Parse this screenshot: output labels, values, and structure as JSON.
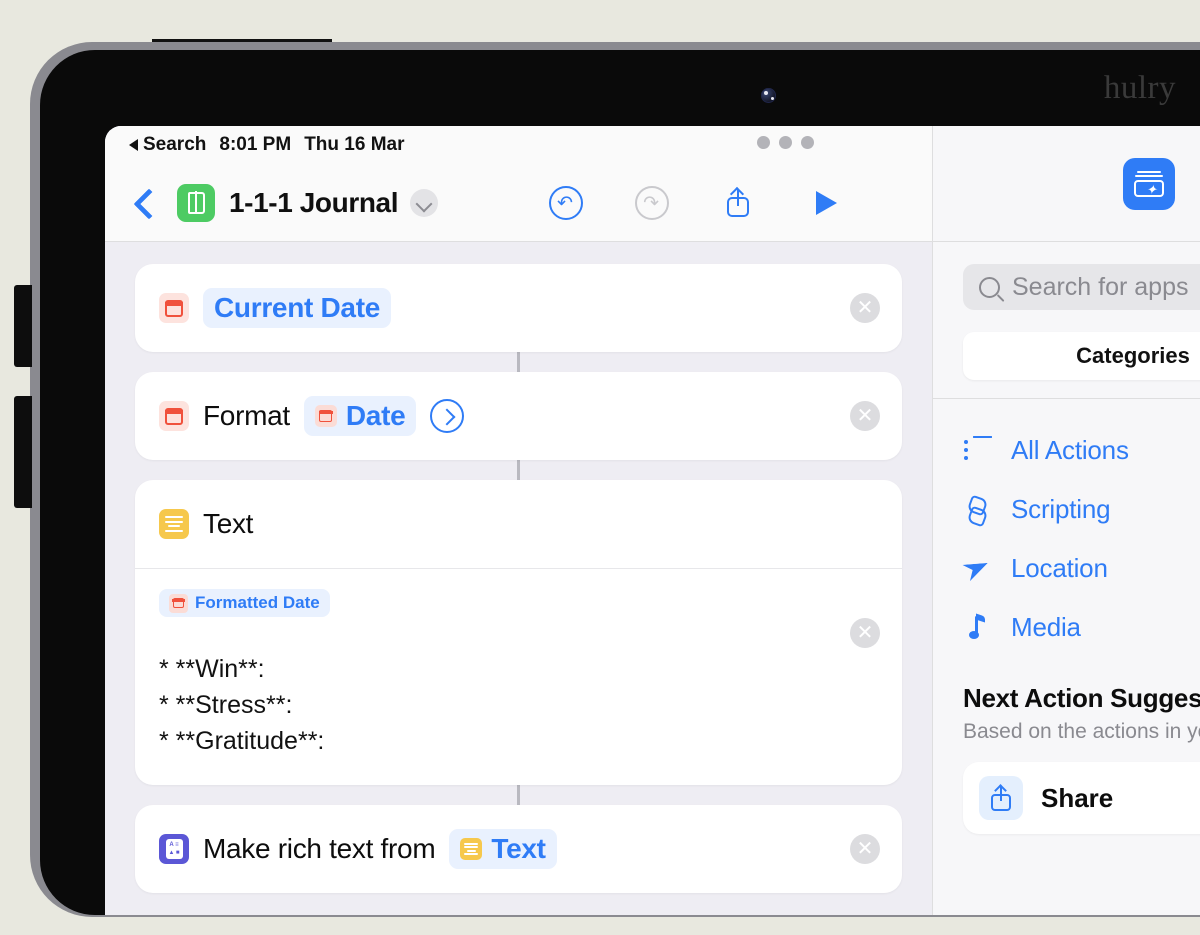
{
  "device": {
    "watermark": "hulry"
  },
  "statusbar": {
    "back_label": "Search",
    "time": "8:01 PM",
    "date": "Thu 16 Mar"
  },
  "navbar": {
    "shortcut_title": "1-1-1 Journal",
    "app_icon": "book-icon",
    "tools": [
      {
        "name": "undo-button",
        "label": "Undo",
        "enabled": true
      },
      {
        "name": "redo-button",
        "label": "Redo",
        "enabled": false
      },
      {
        "name": "share-button",
        "label": "Share",
        "enabled": true
      },
      {
        "name": "play-button",
        "label": "Run",
        "enabled": true
      }
    ]
  },
  "actions": [
    {
      "id": "current-date",
      "icon": "calendar-icon",
      "token_label": "Current Date"
    },
    {
      "id": "format-date",
      "icon": "calendar-icon",
      "prefix": "Format",
      "token_label": "Date",
      "has_disclosure": true
    },
    {
      "id": "text",
      "icon": "text-icon",
      "title": "Text",
      "inline_token": "Formatted Date",
      "body_lines": [
        "* **Win**:",
        "* **Stress**:",
        "* **Gratitude**:"
      ]
    },
    {
      "id": "make-rich-text",
      "icon": "rich-text-icon",
      "prefix": "Make rich text from",
      "token_label": "Text"
    }
  ],
  "sidebar": {
    "add_button_icon": "new-action-icon",
    "search": {
      "placeholder": "Search for apps",
      "value": ""
    },
    "categories_tab": "Categories",
    "items": [
      {
        "label": "All Actions",
        "icon": "list-icon"
      },
      {
        "label": "Scripting",
        "icon": "scripting-icon"
      },
      {
        "label": "Location",
        "icon": "location-arrow-icon"
      },
      {
        "label": "Media",
        "icon": "music-note-icon"
      }
    ],
    "suggestions": {
      "heading": "Next Action Suggestions",
      "subtitle": "Based on the actions in your shortcut",
      "cards": [
        {
          "label": "Share",
          "icon": "share-icon"
        }
      ]
    }
  },
  "colors": {
    "accent_blue": "#2f7cf6",
    "app_green": "#4dcb63",
    "calendar_red": "#f0513c",
    "text_yellow": "#f6c84c",
    "rich_purple": "#5b57d6"
  }
}
